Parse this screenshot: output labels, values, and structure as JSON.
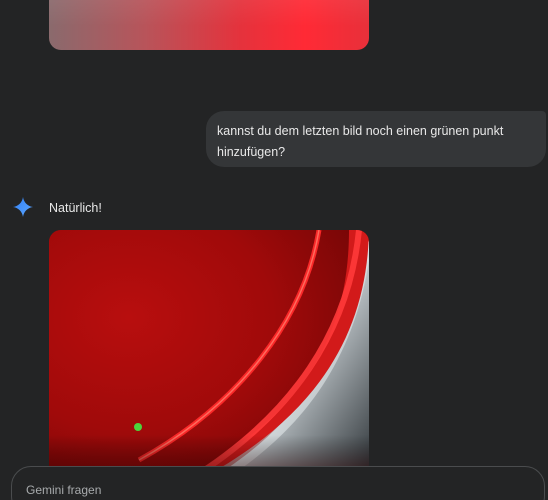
{
  "conversation": {
    "user_message": "kannst du dem letzten bild noch einen grünen punkt hinzufügen?",
    "assistant_name_icon": "gemini-spark-icon",
    "assistant_reply": "Natürlich!"
  },
  "composer": {
    "placeholder": "Gemini fragen"
  },
  "colors": {
    "background": "#232425",
    "user_bubble": "#343638",
    "gemini_blue": "#4a8cf7",
    "green_dot": "#4cd43c"
  }
}
